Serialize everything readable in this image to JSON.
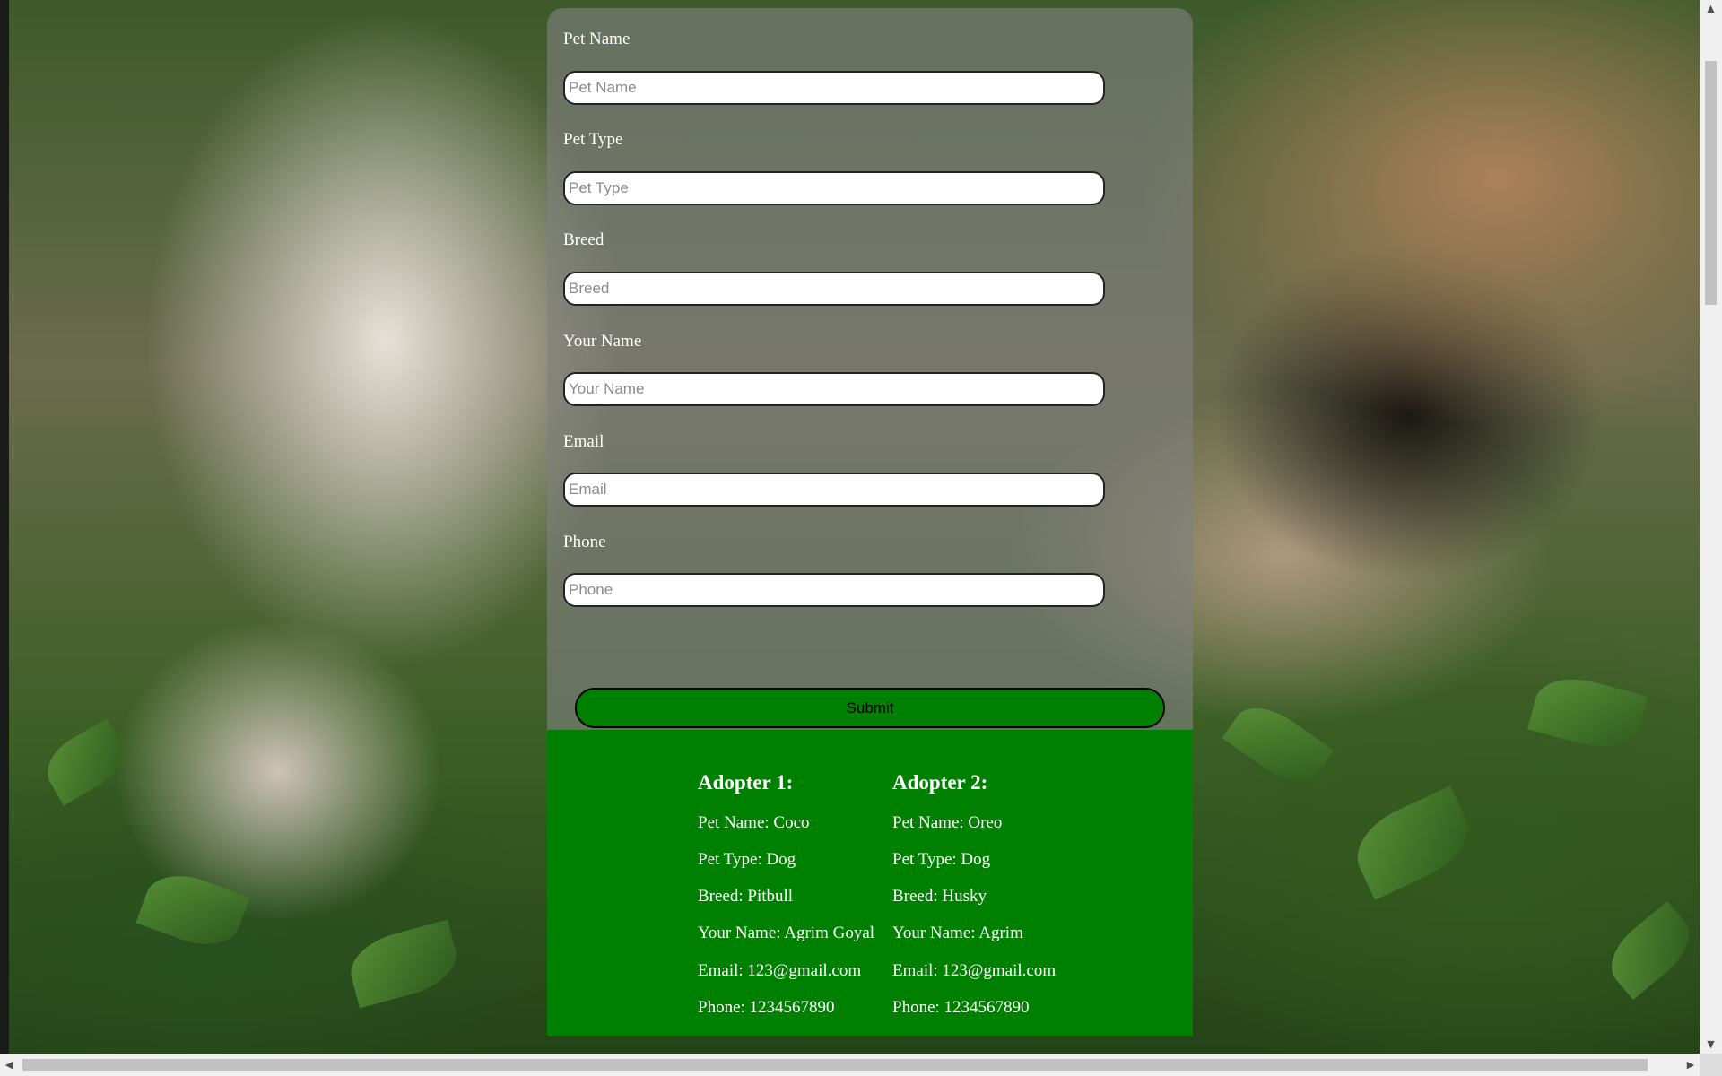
{
  "form": {
    "fields": [
      {
        "label": "Pet Name",
        "placeholder": "Pet Name",
        "value": ""
      },
      {
        "label": "Pet Type",
        "placeholder": "Pet Type",
        "value": ""
      },
      {
        "label": "Breed",
        "placeholder": "Breed",
        "value": ""
      },
      {
        "label": "Your Name",
        "placeholder": "Your Name",
        "value": ""
      },
      {
        "label": "Email",
        "placeholder": "Email",
        "value": ""
      },
      {
        "label": "Phone",
        "placeholder": "Phone",
        "value": ""
      }
    ],
    "submit_label": "Submit"
  },
  "adopters": [
    {
      "title": "Adopter 1:",
      "pet_name": "Pet Name: Coco",
      "pet_type": "Pet Type: Dog",
      "breed": "Breed: Pitbull",
      "your_name": "Your Name: Agrim Goyal",
      "email": "Email: 123@gmail.com",
      "phone": "Phone: 1234567890"
    },
    {
      "title": "Adopter 2:",
      "pet_name": "Pet Name: Oreo",
      "pet_type": "Pet Type: Dog",
      "breed": "Breed: Husky",
      "your_name": "Your Name: Agrim",
      "email": "Email: 123@gmail.com",
      "phone": "Phone: 1234567890"
    }
  ],
  "scrollbars": {
    "up_icon": "▲",
    "down_icon": "▼",
    "left_icon": "◀",
    "right_icon": "▶"
  },
  "colors": {
    "panel_green": "#008000",
    "card_overlay": "rgba(128,128,128,0.62)"
  }
}
